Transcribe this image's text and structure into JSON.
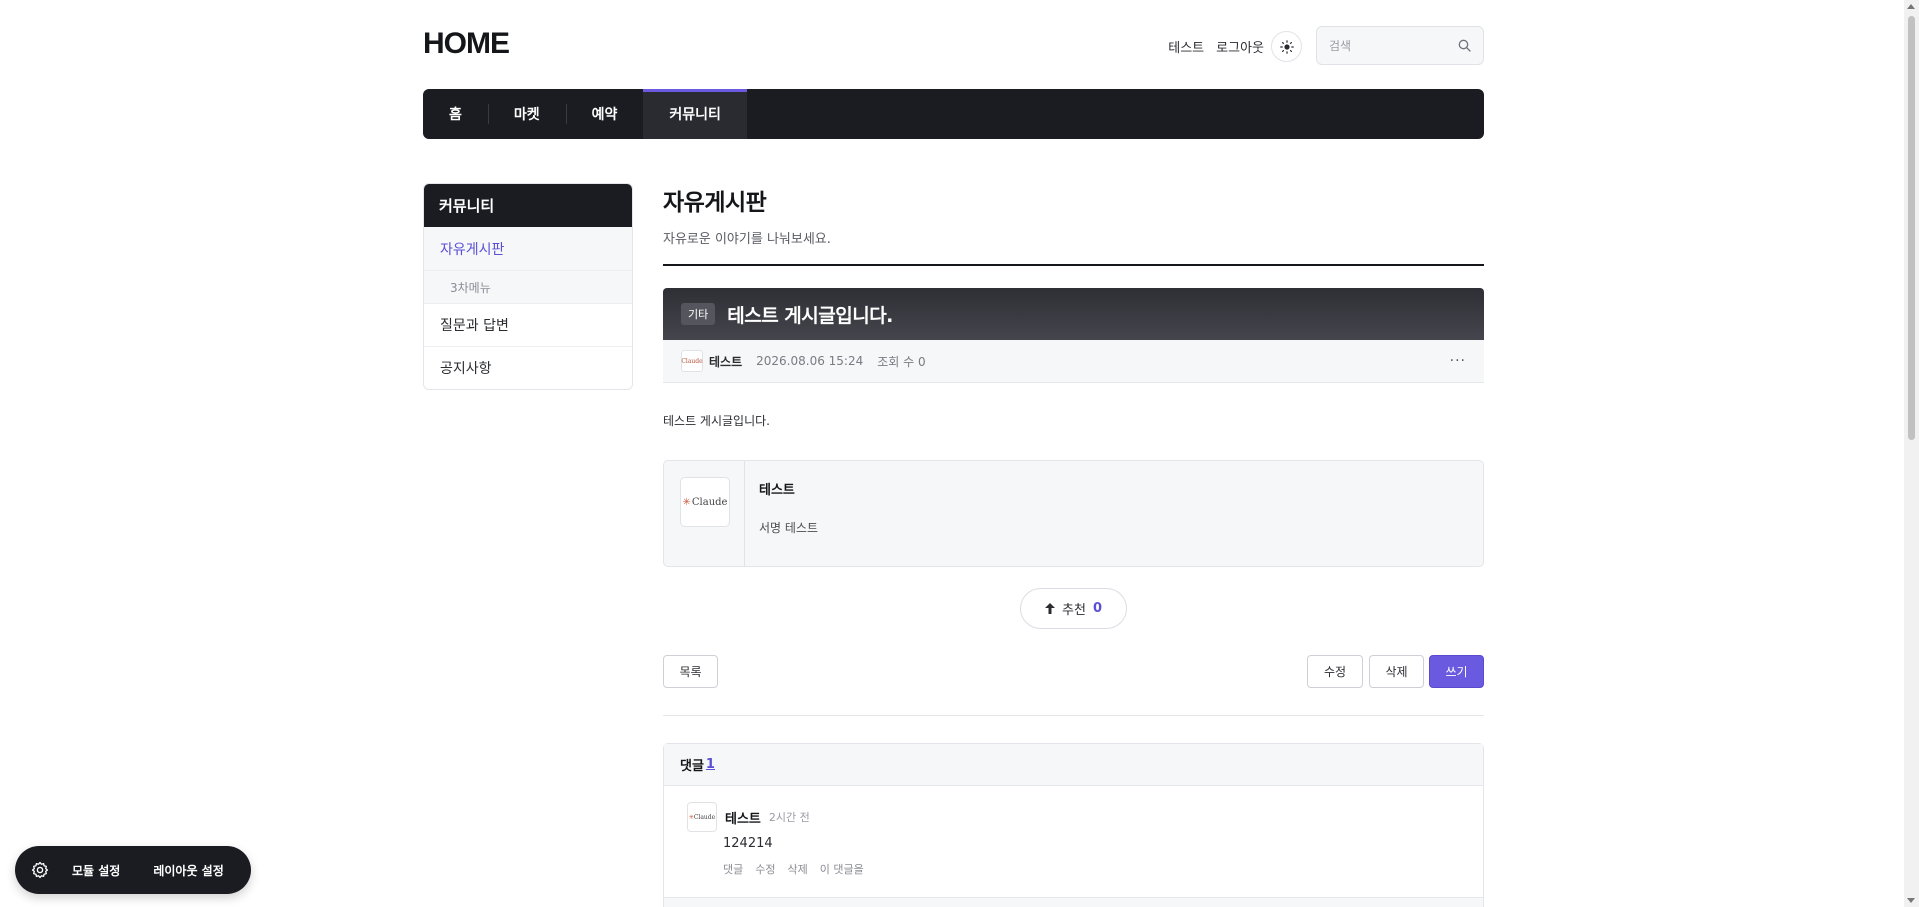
{
  "header": {
    "logo": "HOME",
    "links": [
      "테스트",
      "로그아웃"
    ],
    "search_placeholder": "검색"
  },
  "nav": {
    "items": [
      "홈",
      "마켓",
      "예약",
      "커뮤니티"
    ],
    "active": "커뮤니티"
  },
  "sidebar": {
    "title": "커뮤니티",
    "items": [
      {
        "label": "자유게시판",
        "current": true
      },
      {
        "label": "3차메뉴",
        "sub": true
      },
      {
        "label": "질문과 답변"
      },
      {
        "label": "공지사항"
      }
    ]
  },
  "board": {
    "title": "자유게시판",
    "description": "자유로운 이야기를 나눠보세요."
  },
  "post": {
    "category": "기타",
    "title": "테스트 게시글입니다.",
    "author": "테스트",
    "date": "2026.08.06 15:24",
    "views": "조회 수 0",
    "more": "···",
    "body": "테스트 게시글입니다."
  },
  "avatar_text": "Claude",
  "signature": {
    "name": "테스트",
    "text": "서명 테스트"
  },
  "vote": {
    "label": "추천",
    "count": "0"
  },
  "buttons": {
    "list": "목록",
    "edit": "수정",
    "delete": "삭제",
    "write": "쓰기"
  },
  "comments": {
    "label": "댓글",
    "count": "1",
    "items": [
      {
        "author": "테스트",
        "time": "2시간 전",
        "text": "124214",
        "actions": [
          "댓글",
          "수정",
          "삭제",
          "이 댓글을"
        ]
      }
    ]
  },
  "floating": {
    "module_settings": "모듈 설정",
    "layout_settings": "레이아웃 설정"
  },
  "colors": {
    "accent": "#6a5ae0",
    "dark": "#1b1c21"
  }
}
